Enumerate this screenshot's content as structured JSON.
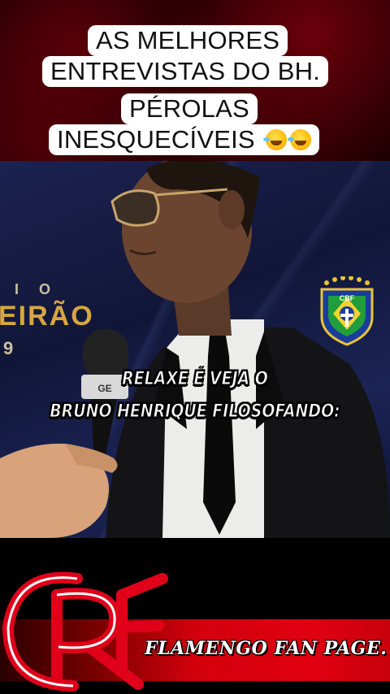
{
  "header": {
    "title_lines": [
      "AS MELHORES",
      "ENTREVISTAS DO BH.",
      "PÉROLAS",
      "INESQUECÍVEIS"
    ],
    "title_emoji": "rolling-on-floor-laughing-emoji"
  },
  "video": {
    "backdrop_text": [
      "I O",
      "EIRÃO",
      "9"
    ],
    "badge_text": "CBF",
    "caption_lines": [
      "RELAXE É VEJA O",
      "BRUNO HENRIQUE FILOSOFANDO:"
    ]
  },
  "footer": {
    "label": "FLAMENGO FAN PAGE."
  },
  "colors": {
    "banner_red": "#d3000c",
    "title_bg": "#ffffff",
    "backdrop_gold": "#d8a640",
    "navy": "#141a45"
  }
}
